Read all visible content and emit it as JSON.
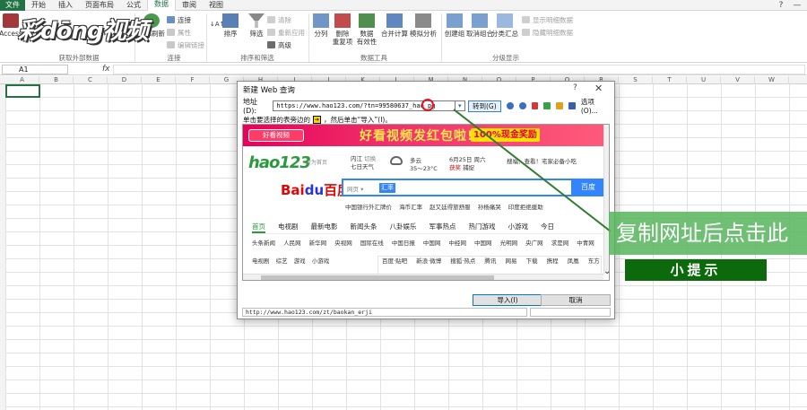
{
  "ribbon_tabs": [
    "文件",
    "开始",
    "插入",
    "页面布局",
    "公式",
    "数据",
    "审阅",
    "视图"
  ],
  "active_tab": "数据",
  "window_controls": [
    "?",
    "—"
  ],
  "ribbon": {
    "access_label": "Access",
    "get_external_group": "获取外部数据",
    "refresh_all": "全部刷新",
    "connections_small": [
      "连接",
      "属性",
      "编辑链接"
    ],
    "connections_group": "连接",
    "sort_az": "↓A↑Z",
    "sort": "排序",
    "filter": "筛选",
    "filter_small": [
      "清除",
      "重新应用",
      "高级"
    ],
    "sort_filter_group": "排序和筛选",
    "split": "分列",
    "remove_dup": "删除\n重复项",
    "validation": "数据\n有效性",
    "consolidate": "合并计算",
    "whatif": "模拟分析",
    "data_tools_group": "数据工具",
    "group": "创建组",
    "ungroup": "取消组合",
    "subtotal": "分类汇总",
    "outline_small": [
      "显示明细数据",
      "隐藏明细数据"
    ],
    "outline_group": "分级显示"
  },
  "formula_bar": {
    "name_box": "A1",
    "fx": "fx"
  },
  "columns": [
    "A",
    "B",
    "C",
    "D",
    "E",
    "F",
    "G",
    "H",
    "I",
    "J",
    "K",
    "L",
    "M",
    "N",
    "O",
    "P",
    "Q",
    "R",
    "S",
    "T",
    "U",
    "V",
    "W"
  ],
  "dialog": {
    "title": "新建 Web 查询",
    "help": "?",
    "close": "✕",
    "address_label": "地址(D):",
    "address_value": "https://www.hao123.com/?tn=99580637_hao_pg",
    "go_button": "转到(G)",
    "options_button": "选项(O)...",
    "hint_prefix": "单击要选择的表旁边的",
    "hint_arrow": "➔",
    "hint_suffix": "，然后单击“导入”(I)。",
    "import_button": "导入(I)",
    "cancel_button": "取消",
    "status_url": "http://www.hao123.com/zt/baokan_erji"
  },
  "web": {
    "banner_logo": "好看视频",
    "banner_text": "好看视频发红包啦!",
    "banner_tag": "100%现金奖励",
    "hao_logo": "hao123",
    "hao_sub": "设为首页",
    "weather_city": "内江",
    "weather_switch": "切换",
    "weather_days": "七日天气",
    "weather_today": "多云",
    "weather_temp": "35～23°C",
    "date": "6月25日",
    "weekday": "周六",
    "lunar": "获奖",
    "lunar2": "捕捉",
    "search_tip": "搜福：查看！宅家必备小吃",
    "baidu_logo_a": "Bai",
    "baidu_logo_b": "du",
    "baidu_logo_c": "百度",
    "search_type": "网页 ▾",
    "search_text": "汇率",
    "search_button": "百度",
    "hot_links": "中国银行外汇牌价 海币汇率 赵又廷得旅舒服 孙杨痛哭 印度拒绝援助",
    "nav_tabs": [
      "首页",
      "电视剧",
      "最新电影",
      "新闻头条",
      "八卦娱乐",
      "军事热点",
      "热门游戏",
      "小游戏",
      "今日"
    ],
    "site_row": "头条新闻 人民网 新华网 央视网 国际在线 中国日报 中国网 中经网 中国网 光明网 央广网 求是网 中青网",
    "lower_left": "电视剧 综艺 游戏 小游戏",
    "lower_right": "百度·贴吧 新浪·微博 搜狐·热点 腾讯 网易 下载 携程 凤凰 东方 淘宝"
  },
  "overlay": {
    "logo": "彩dōng视频",
    "callout": "复制网址后点击此",
    "tip": "小提示"
  },
  "colors": {
    "excel_green": "#217346",
    "accent_blue": "#3385ff",
    "callout_green": "#56b45c",
    "tip_green": "#0c6a0c",
    "marker_red": "#e81123"
  }
}
